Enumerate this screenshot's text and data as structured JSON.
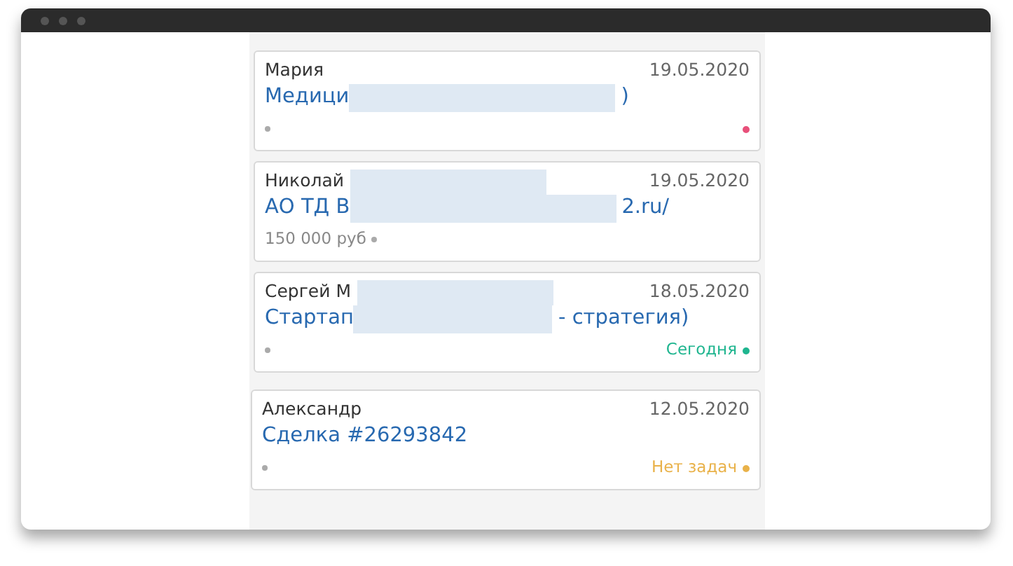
{
  "deals": [
    {
      "contact": "Мария",
      "contact_redacted": false,
      "date": "19.05.2020",
      "title": "Медици",
      "title_redacted": true,
      "title_end": ")",
      "task": {
        "color": "#e8507a"
      }
    },
    {
      "contact": "Николай",
      "contact_redacted": true,
      "date": "19.05.2020",
      "title": "АО ТД В",
      "title_redacted": true,
      "title_end": "2.ru/",
      "amount": "150 000 руб"
    },
    {
      "contact": "Сергей М",
      "contact_redacted": true,
      "date": "18.05.2020",
      "title": "Стартап",
      "title_redacted": true,
      "title_end": "- стратегия)",
      "task": {
        "label": "Сегодня",
        "color": "#1fb58f"
      }
    },
    {
      "contact": "Александр",
      "contact_redacted": false,
      "date": "12.05.2020",
      "title": "Сделка #26293842",
      "title_redacted": false,
      "task": {
        "label": "Нет задач",
        "color": "#e9b24a"
      }
    }
  ]
}
